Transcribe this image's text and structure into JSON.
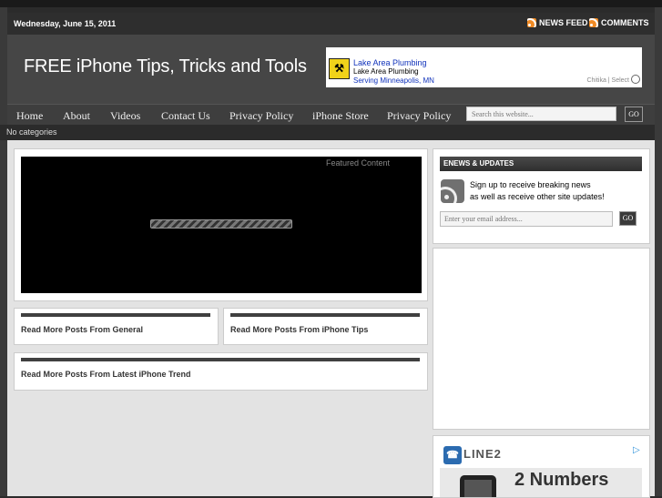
{
  "topbar": {
    "date": "Wednesday, June 15, 2011",
    "news_feed": "NEWS FEED",
    "comments": "COMMENTS"
  },
  "header": {
    "site_title": "FREE iPhone Tips, Tricks and Tools",
    "ad": {
      "title": "Lake Area Plumbing",
      "line2": "Lake Area Plumbing",
      "line3": "Serving Minneapolis, MN",
      "footer": "Chitika | Select"
    }
  },
  "nav": {
    "items": [
      "Home",
      "About",
      "Videos",
      "Contact Us",
      "Privacy Policy",
      "iPhone Store",
      "Privacy Policy"
    ],
    "search_placeholder": "Search this website...",
    "go": "GO"
  },
  "categories": "No categories",
  "featured": {
    "label": "Featured Content"
  },
  "posts": [
    "Read More Posts From General",
    "Read More Posts From iPhone Tips",
    "Read More Posts From Latest iPhone Trend"
  ],
  "sidebar": {
    "enews_title": "ENEWS & UPDATES",
    "enews_line1": "Sign up to receive breaking news",
    "enews_line2": "as well as receive other site updates!",
    "email_placeholder": "Enter your email address...",
    "go": "GO",
    "ad": {
      "brand": "LINE2",
      "headline": "2 Numbers"
    }
  },
  "colors": {
    "rss": "#f08a24",
    "ad_link": "#1133bb"
  }
}
